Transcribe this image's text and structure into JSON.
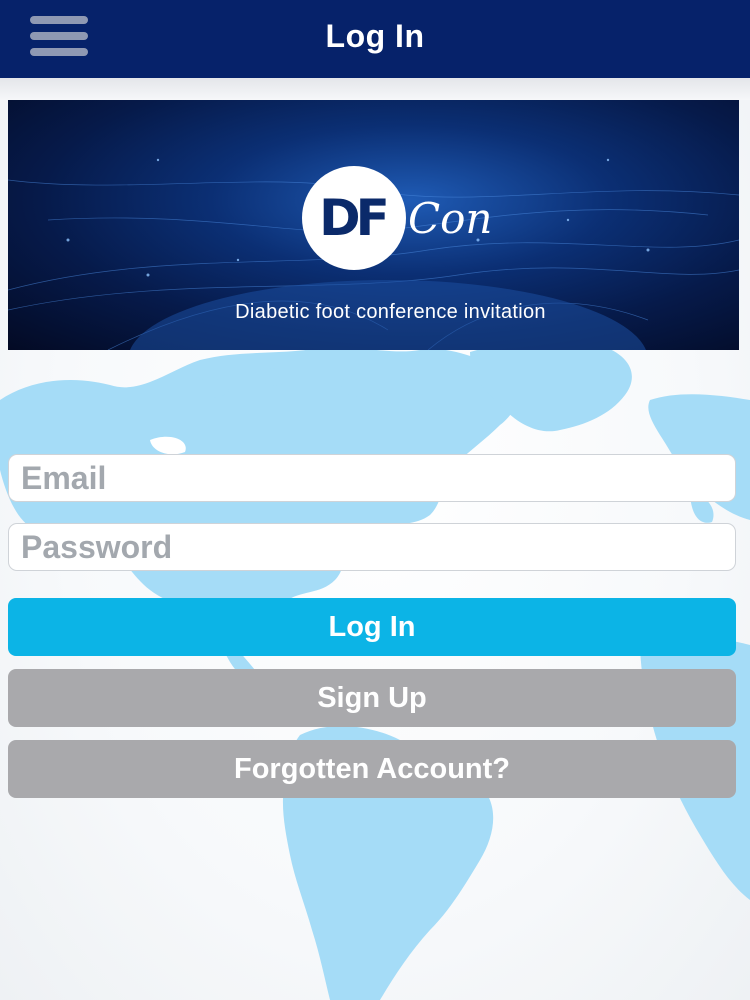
{
  "header": {
    "title": "Log In",
    "background_color": "#06226a",
    "menu_icon": "hamburger-menu-icon"
  },
  "banner": {
    "logo_initials": "DF",
    "logo_suffix": "Con",
    "tagline": "Diabetic foot conference invitation",
    "background_color": "#061a4a"
  },
  "form": {
    "email_placeholder": "Email",
    "email_value": "",
    "password_placeholder": "Password",
    "password_value": ""
  },
  "buttons": {
    "login_label": "Log In",
    "signup_label": "Sign Up",
    "forgot_label": "Forgotten Account?"
  },
  "colors": {
    "primary_button": "#0cb4e6",
    "secondary_button": "#a9a9ac",
    "map_land": "#a5dcf7"
  }
}
